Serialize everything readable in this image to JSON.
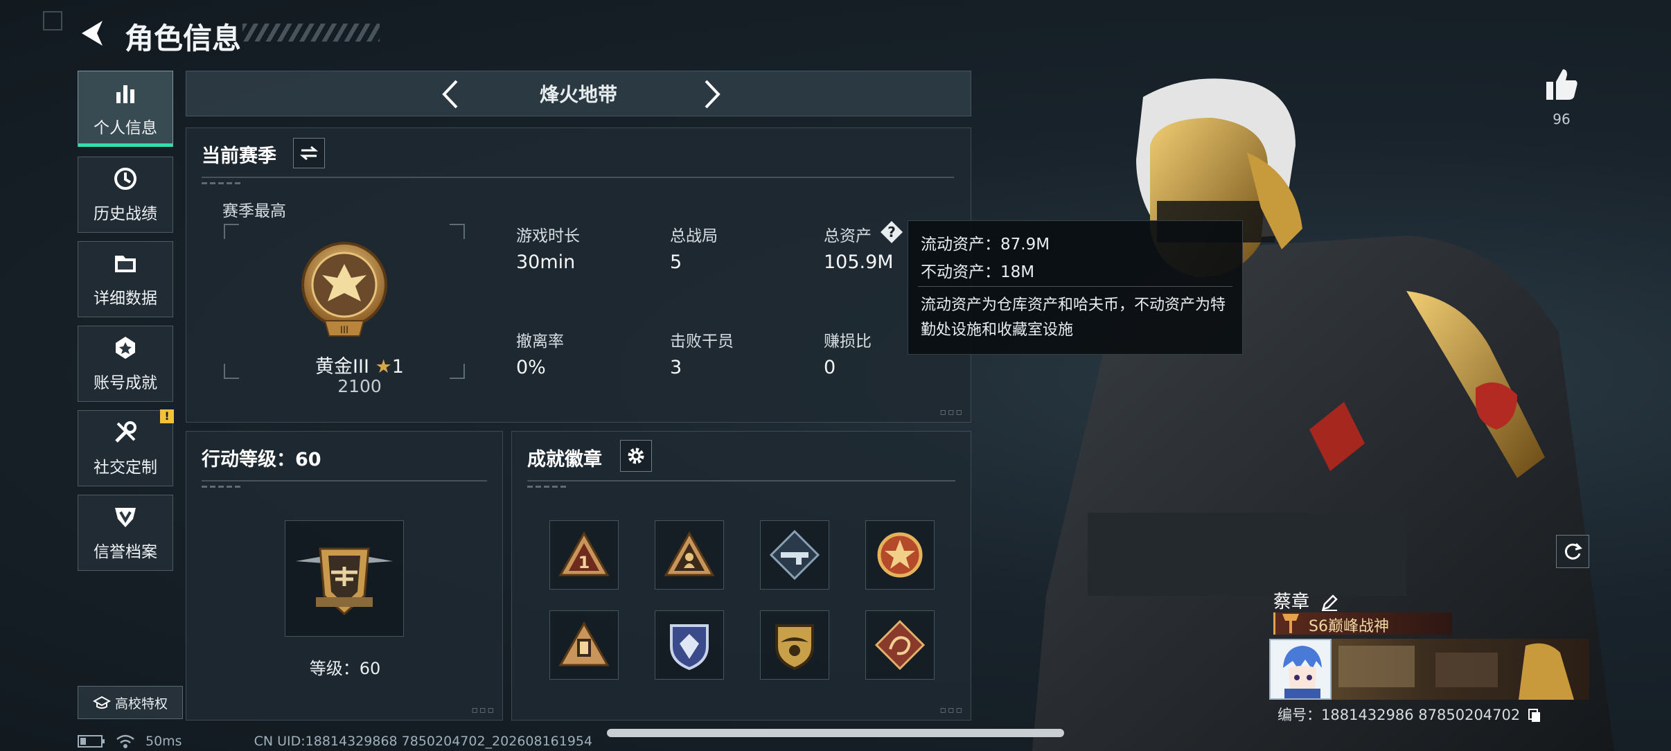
{
  "header": {
    "title": "角色信息"
  },
  "sidebar": {
    "items": [
      {
        "label": "个人信息",
        "icon": "bar-chart-icon"
      },
      {
        "label": "历史战绩",
        "icon": "history-clock-icon"
      },
      {
        "label": "详细数据",
        "icon": "folder-icon"
      },
      {
        "label": "账号成就",
        "icon": "achievement-icon"
      },
      {
        "label": "社交定制",
        "icon": "tools-icon"
      },
      {
        "label": "信誉档案",
        "icon": "credit-shield-icon"
      }
    ],
    "social_badge": "!",
    "school_button": "高校特权"
  },
  "mode_bar": {
    "mode": "烽火地带"
  },
  "season": {
    "title": "当前赛季",
    "best_label": "赛季最高",
    "rank_name": "黄金III",
    "rank_stars": "1",
    "rank_points": "2100",
    "stats": [
      {
        "label": "游戏时长",
        "value": "30min"
      },
      {
        "label": "总战局",
        "value": "5"
      },
      {
        "label": "总资产",
        "value": "105.9M"
      },
      {
        "label": "撤离率",
        "value": "0%"
      },
      {
        "label": "击败干员",
        "value": "3"
      },
      {
        "label": "赚损比",
        "value": "0"
      }
    ]
  },
  "tooltip": {
    "liquid": "流动资产：87.9M",
    "fixed": "不动资产：18M",
    "desc": "流动资产为仓库资产和哈夫币，不动资产为特勤处设施和收藏室设施"
  },
  "action_level": {
    "title": "行动等级：60",
    "level_text": "等级：60"
  },
  "achievements": {
    "title": "成就徽章"
  },
  "likes": {
    "count": "96"
  },
  "player": {
    "name": "蔡章",
    "title": "S6巅峰战神",
    "uid_line": "编号：1881432986 87850204702"
  },
  "status": {
    "ping": "50ms",
    "uid": "CN UID:18814329868 7850204702_202608161954"
  },
  "colors": {
    "accent": "#2fe0a8",
    "gold": "#d6a64a",
    "warning": "#f3c13a"
  }
}
